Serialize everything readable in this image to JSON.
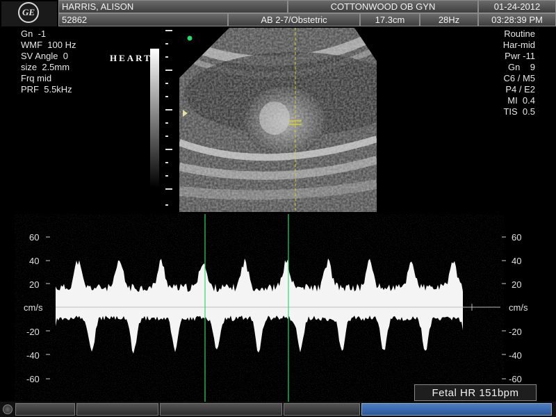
{
  "header": {
    "patient_name": "HARRIS, ALISON",
    "patient_id": "52862",
    "institution": "COTTONWOOD OB GYN",
    "date": "01-24-2012",
    "time": "03:28:39 PM",
    "probe_mode": "AB 2-7/Obstetric",
    "depth": "17.3cm",
    "frame_rate": "28Hz",
    "logo_text": "GE"
  },
  "left_params": [
    "Gn  -1",
    "WMF  100 Hz",
    "SV Angle  0",
    "size  2.5mm",
    "Frq mid",
    "PRF  5.5kHz"
  ],
  "right_params": [
    "Routine",
    "Har-mid",
    "Pwr -11",
    "Gn    9",
    "C6 / M5",
    "P4 / E2",
    "MI  0.4",
    "TIS  0.5"
  ],
  "preset_label": "HEART",
  "doppler": {
    "unit": "cm/s",
    "left_ticks": [
      "60",
      "40",
      "20",
      "-20",
      "-40",
      "-60"
    ],
    "right_ticks": [
      "60",
      "40",
      "20",
      "-20",
      "-40",
      "-60"
    ]
  },
  "fetal_hr": "Fetal HR 151bpm",
  "colors": {
    "accent_green": "#22dd66",
    "caliper_yellow": "#d8d020",
    "status_blue": "#3a6fb5"
  }
}
